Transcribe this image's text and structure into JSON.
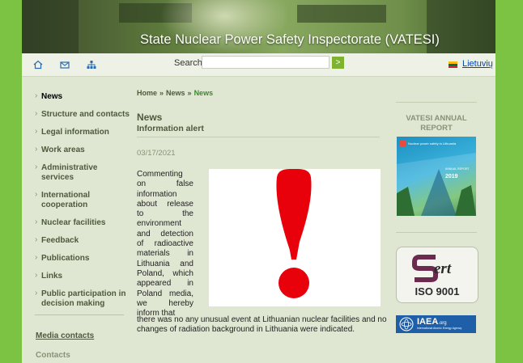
{
  "header": {
    "title": "State Nuclear Power Safety Inspectorate (VATESI)"
  },
  "topbar": {
    "search_label": "Search:",
    "search_button": ">",
    "language": "Lietuvių",
    "icons": [
      "home-icon",
      "mail-icon",
      "sitemap-icon",
      "lithuania-flag-icon"
    ]
  },
  "nav": {
    "items": [
      {
        "label": "News",
        "active": true
      },
      {
        "label": "Structure and contacts"
      },
      {
        "label": "Legal information"
      },
      {
        "label": "Work areas"
      },
      {
        "label": "Administrative services"
      },
      {
        "label": "International cooperation"
      },
      {
        "label": "Nuclear facilities"
      },
      {
        "label": "Feedback"
      },
      {
        "label": "Publications"
      },
      {
        "label": "Links"
      },
      {
        "label": "Public participation in decision making"
      }
    ],
    "media_contacts": "Media contacts",
    "contacts": "Contacts"
  },
  "breadcrumb": {
    "items": [
      "Home",
      "News",
      "News"
    ],
    "separator": "»"
  },
  "article": {
    "title": "News",
    "subtitle": "Information alert",
    "date": "03/17/2021",
    "text_left": "Commenting on false information about release to the environment and detection of radioactive materials in Lithuania and Poland, which appeared in Poland media, we hereby inform that",
    "text_bottom": "there was no any unusual event at Lithuanian nuclear facilities and no changes of radiation background in Lithuania were indicated.",
    "image_icon": "exclamation-icon",
    "alert_color": "#e8000b"
  },
  "aside": {
    "report_title": "VATESI ANNUAL REPORT",
    "report_cover_text": "Nuclear power safety in Lithuania",
    "report_cover_label": "ANNUAL REPORT",
    "report_cover_year": "2019",
    "cert_brand": "ert",
    "cert_iso": "ISO 9001",
    "iaea_name": "IAEA",
    "iaea_org": ".org",
    "iaea_sub": "International Atomic Energy Agency"
  },
  "colors": {
    "page_bg": "#7cc243",
    "content_bg": "#dfe6d2",
    "link": "#0645ad",
    "nav_text": "#4d5a3b"
  }
}
